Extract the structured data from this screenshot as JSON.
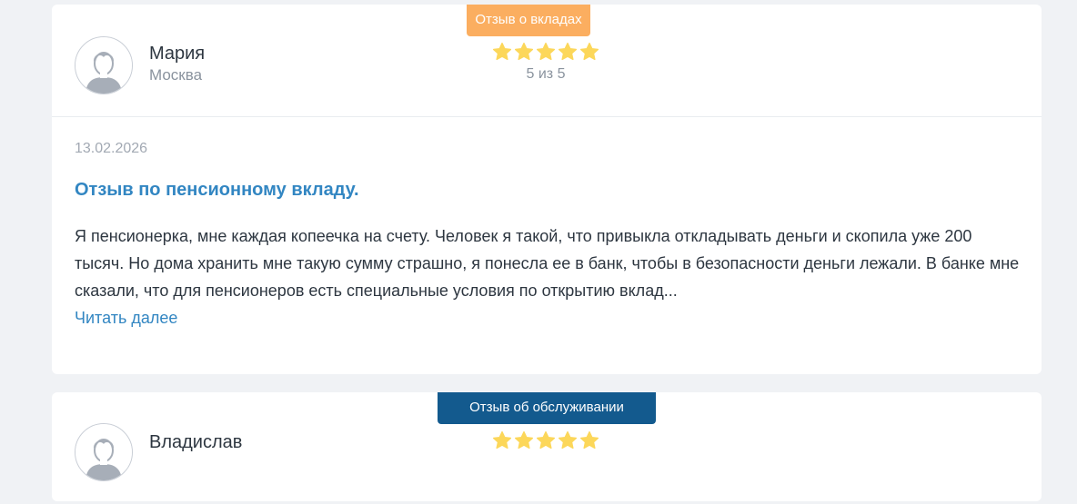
{
  "reviews": [
    {
      "badge": "Отзыв о вкладах",
      "author": "Мария",
      "city": "Москва",
      "rating": 5,
      "score_text": "5 из 5",
      "date": "13.02.2026",
      "title": "Отзыв по пенсионному вкладу.",
      "text": "Я пенсионерка, мне каждая копеечка на счету. Человек я такой, что привыкла откладывать деньги и скопила уже 200 тысяч. Но дома хранить мне такую сумму страшно, я понесла ее в банк, чтобы в безопасности деньги лежали. В банке мне сказали, что для пенсионеров есть специальные условия по открытию вклад...",
      "read_more": "Читать далее"
    },
    {
      "badge": "Отзыв об обслуживании",
      "author": "Владислав",
      "rating": 5
    }
  ],
  "colors": {
    "badge_orange": "#fbae60",
    "badge_blue": "#135a8e",
    "link": "#3286c2",
    "star": "#fcd75a"
  },
  "icons": {
    "avatar": "user-avatar-icon",
    "star": "star-icon"
  }
}
